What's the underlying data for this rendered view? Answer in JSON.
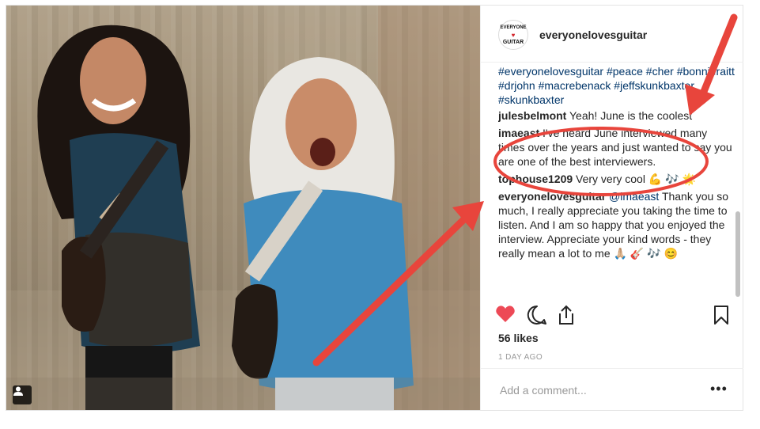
{
  "post": {
    "username": "everyonelovesguitar",
    "avatar_text_top": "EVERYONE",
    "avatar_heart": "♥",
    "avatar_text_bottom": "GUITAR",
    "hashtags": "#everyonelovesguitar #peace #cher #bonnieraitt #drjohn #macrebenack #jeffskunkbaxter #skunkbaxter",
    "comments": [
      {
        "user": "julesbelmont",
        "text": "Yeah! June is the coolest"
      },
      {
        "user": "imaeast",
        "text": "I've heard June interviewed many times over the years and just wanted to say you are one of the best interviewers."
      },
      {
        "user": "tophouse1209",
        "text": "Very very cool 💪 🎶 🌟"
      },
      {
        "user": "everyonelovesguitar",
        "mention": "@imaeast",
        "text": "Thank you so much, I really appreciate you taking the time to listen. And I am so happy that you enjoyed the interview. Appreciate your kind words - they really mean a lot to me 🙏🏼 🎸 🎶 😊"
      }
    ],
    "likes": "56 likes",
    "time_ago": "1 DAY AGO",
    "comment_placeholder": "Add a comment...",
    "more_label": "•••",
    "accent_like": "#ed4956",
    "annotation_color": "#e8453c"
  },
  "icons": [
    "heart-icon",
    "comment-icon",
    "share-icon",
    "bookmark-icon",
    "user-tag-icon"
  ]
}
